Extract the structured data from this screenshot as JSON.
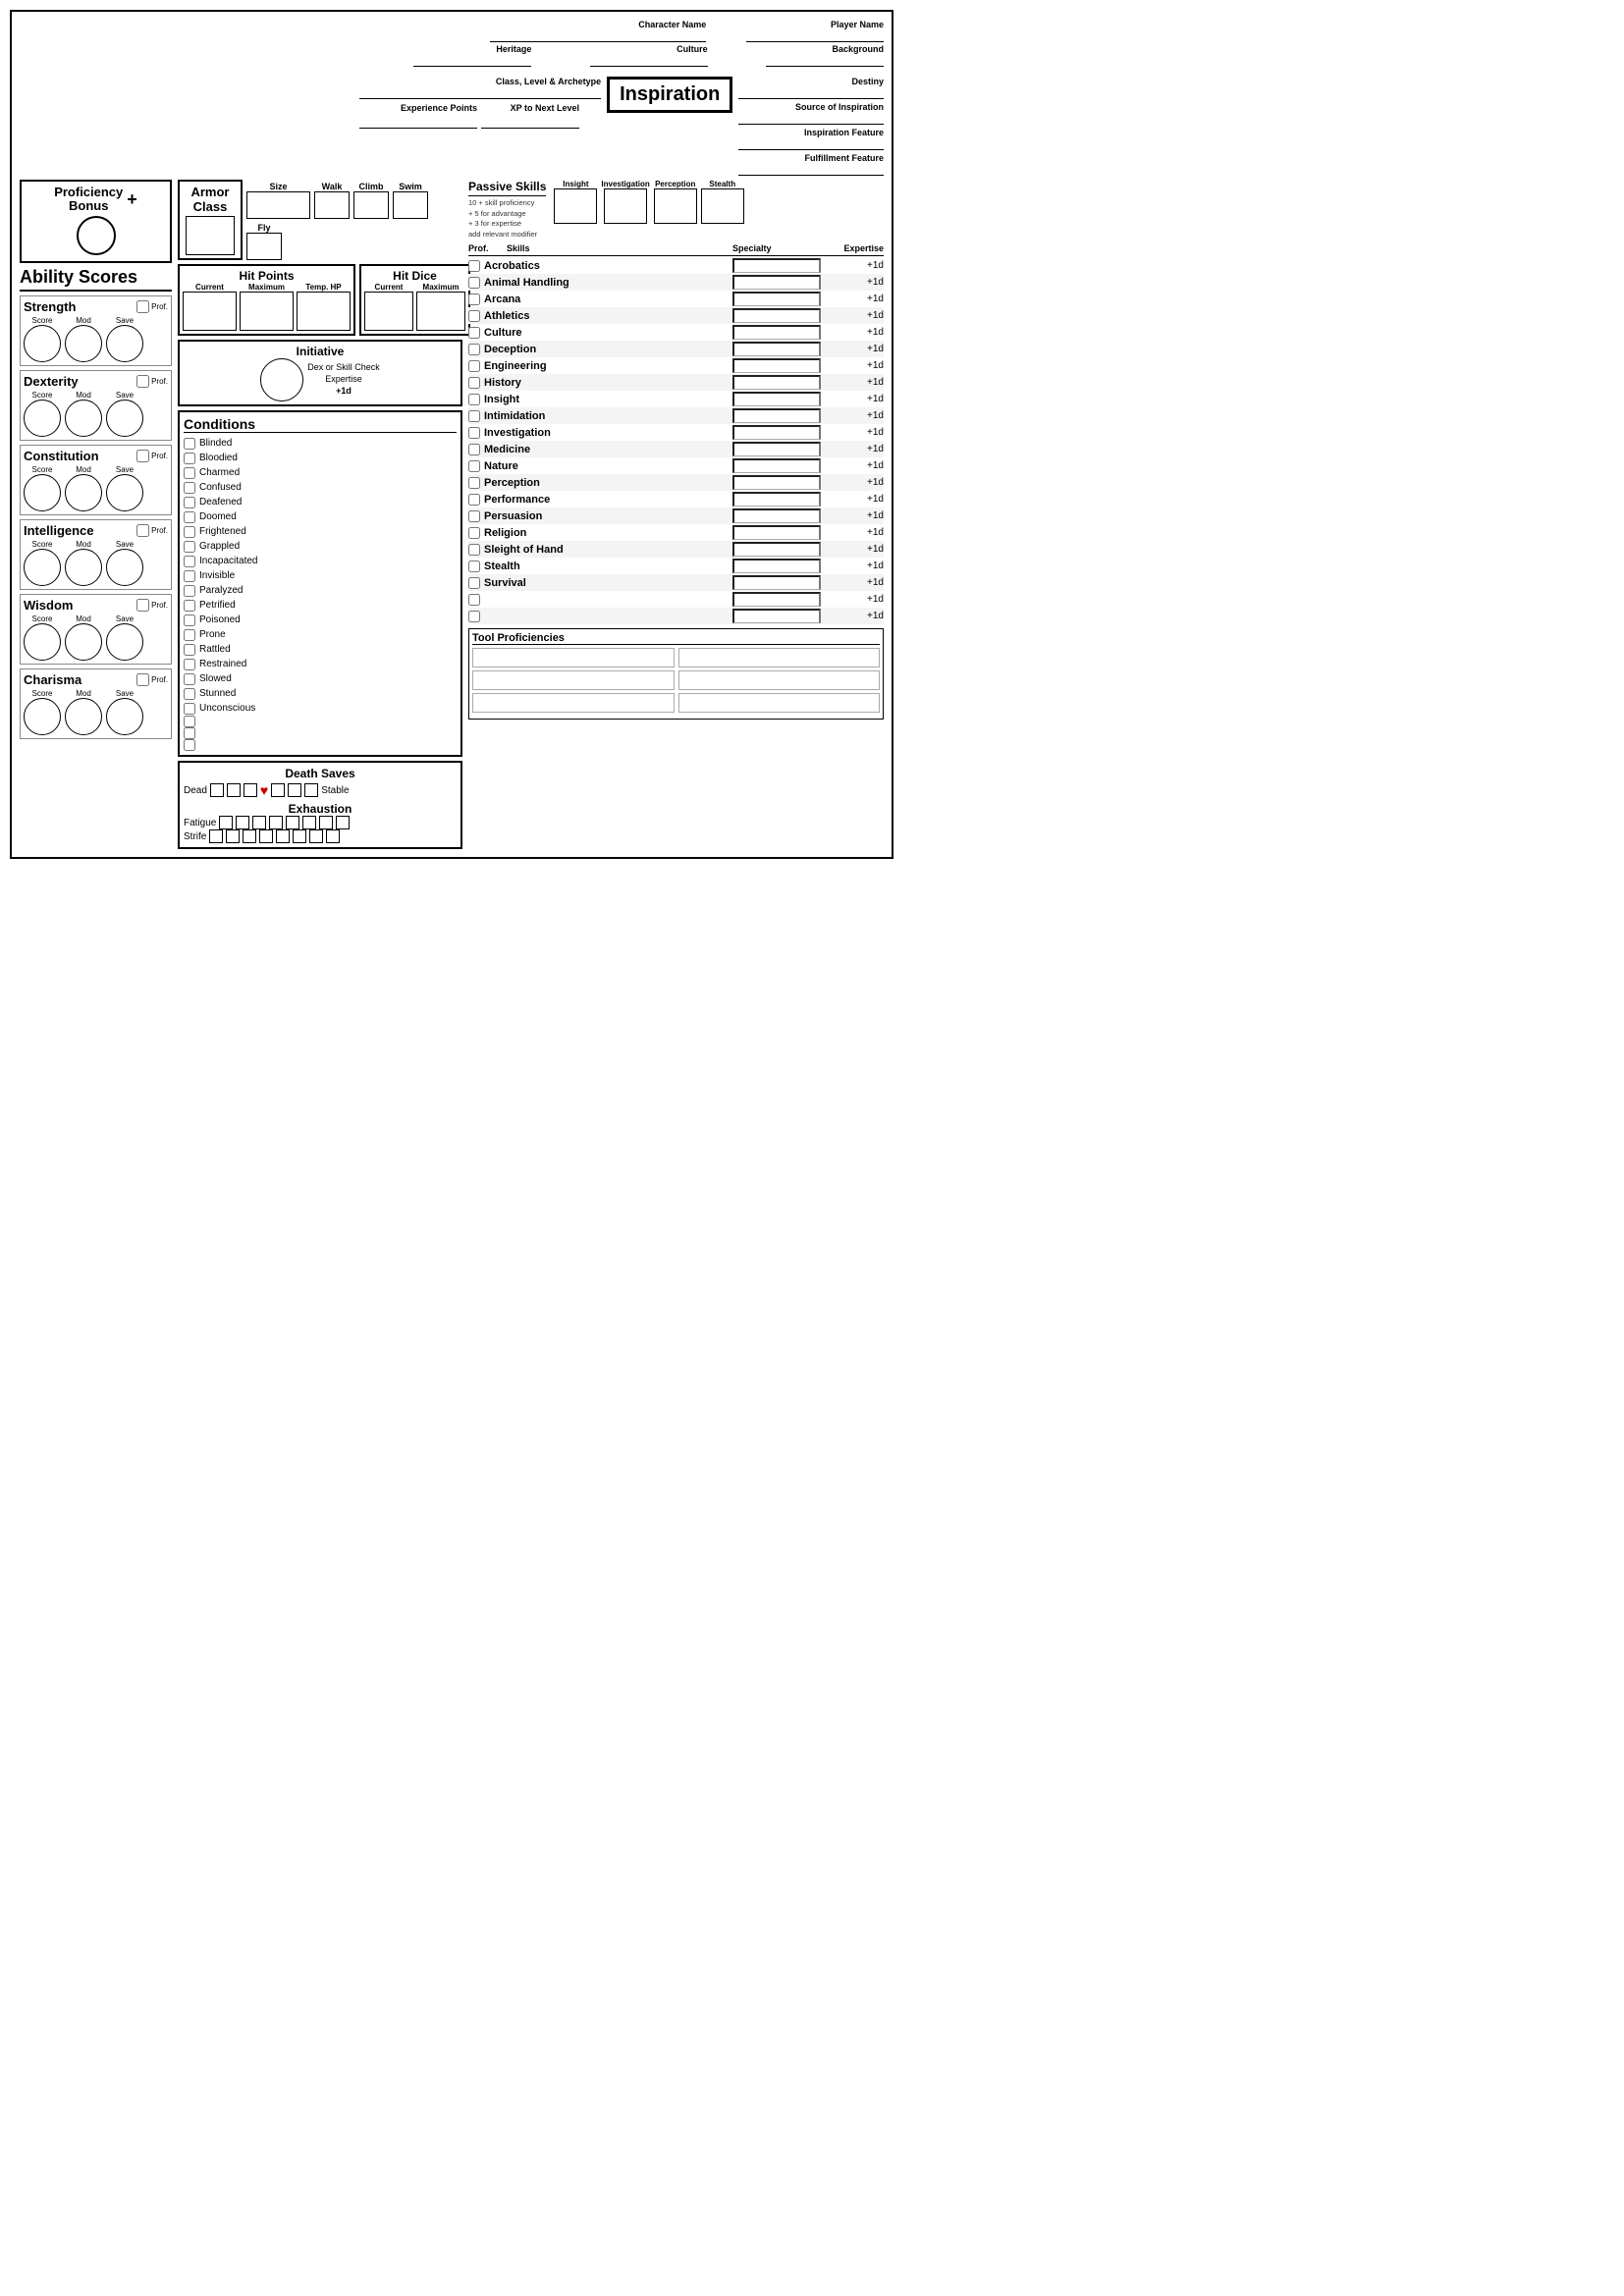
{
  "header": {
    "character_name_label": "Character Name",
    "player_name_label": "Player Name",
    "heritage_label": "Heritage",
    "culture_label": "Culture",
    "background_label": "Background",
    "class_level_label": "Class, Level & Archetype",
    "destiny_label": "Destiny",
    "xp_label": "Experience Points",
    "xp_next_label": "XP to Next Level"
  },
  "inspiration": {
    "label": "Inspiration",
    "source_label": "Source of Inspiration",
    "feature_label": "Inspiration Feature",
    "fulfillment_label": "Fulfillment Feature"
  },
  "proficiency": {
    "label": "Proficiency\nBonus",
    "plus": "+"
  },
  "ability_scores": {
    "section_label": "Ability Scores",
    "abilities": [
      {
        "name": "Strength",
        "score_label": "Score",
        "mod_label": "Mod",
        "save_label": "Save",
        "prof_label": "Prof."
      },
      {
        "name": "Dexterity",
        "score_label": "Score",
        "mod_label": "Mod",
        "save_label": "Save",
        "prof_label": "Prof."
      },
      {
        "name": "Constitution",
        "score_label": "Score",
        "mod_label": "Mod",
        "save_label": "Save",
        "prof_label": "Prof."
      },
      {
        "name": "Intelligence",
        "score_label": "Score",
        "mod_label": "Mod",
        "save_label": "Save",
        "prof_label": "Prof."
      },
      {
        "name": "Wisdom",
        "score_label": "Score",
        "mod_label": "Mod",
        "save_label": "Save",
        "prof_label": "Prof."
      },
      {
        "name": "Charisma",
        "score_label": "Score",
        "mod_label": "Mod",
        "save_label": "Save",
        "prof_label": "Prof."
      }
    ]
  },
  "armor": {
    "label": "Armor\nClass",
    "size_label": "Size",
    "walk_label": "Walk",
    "climb_label": "Climb",
    "swim_label": "Swim",
    "fly_label": "Fly"
  },
  "hit_points": {
    "title": "Hit Points",
    "current_label": "Current",
    "maximum_label": "Maximum",
    "temp_label": "Temp. HP"
  },
  "hit_dice": {
    "title": "Hit Dice",
    "current_label": "Current",
    "maximum_label": "Maximum"
  },
  "initiative": {
    "title": "Initiative",
    "dex_label": "Dex",
    "or_label": "or",
    "skill_check_label": "Skill\nCheck",
    "expertise_label": "Expertise",
    "bonus_label": "+1d"
  },
  "conditions": {
    "title": "Conditions",
    "list": [
      "Blinded",
      "Bloodied",
      "Charmed",
      "Confused",
      "Deafened",
      "Doomed",
      "Frightened",
      "Grappled",
      "Incapacitated",
      "Invisible",
      "Paralyzed",
      "Petrified",
      "Poisoned",
      "Prone",
      "Rattled",
      "Restrained",
      "Slowed",
      "Stunned",
      "Unconscious",
      "",
      "",
      ""
    ]
  },
  "death_saves": {
    "title": "Death Saves",
    "dead_label": "Dead",
    "stable_label": "Stable",
    "exhaustion_title": "Exhaustion",
    "fatigue_label": "Fatigue",
    "strife_label": "Strife"
  },
  "passive_skills": {
    "title": "Passive Skills",
    "notes": "10 + skill proficiency\n+ 5 for advantage\n+ 3 for expertise\nadd relevant modifier",
    "insight_label": "Insight",
    "investigation_label": "Investigation",
    "perception_label": "Perception",
    "stealth_label": "Stealth"
  },
  "skills": {
    "prof_header": "Prof.",
    "skill_header": "Skills",
    "specialty_header": "Specialty",
    "expertise_header": "Expertise",
    "list": [
      {
        "name": "Acrobatics",
        "bonus": "+1d"
      },
      {
        "name": "Animal Handling",
        "bonus": "+1d"
      },
      {
        "name": "Arcana",
        "bonus": "+1d"
      },
      {
        "name": "Athletics",
        "bonus": "+1d"
      },
      {
        "name": "Culture",
        "bonus": "+1d"
      },
      {
        "name": "Deception",
        "bonus": "+1d"
      },
      {
        "name": "Engineering",
        "bonus": "+1d"
      },
      {
        "name": "History",
        "bonus": "+1d"
      },
      {
        "name": "Insight",
        "bonus": "+1d"
      },
      {
        "name": "Intimidation",
        "bonus": "+1d"
      },
      {
        "name": "Investigation",
        "bonus": "+1d"
      },
      {
        "name": "Medicine",
        "bonus": "+1d"
      },
      {
        "name": "Nature",
        "bonus": "+1d"
      },
      {
        "name": "Perception",
        "bonus": "+1d"
      },
      {
        "name": "Performance",
        "bonus": "+1d"
      },
      {
        "name": "Persuasion",
        "bonus": "+1d"
      },
      {
        "name": "Religion",
        "bonus": "+1d"
      },
      {
        "name": "Sleight of Hand",
        "bonus": "+1d"
      },
      {
        "name": "Stealth",
        "bonus": "+1d"
      },
      {
        "name": "Survival",
        "bonus": "+1d"
      },
      {
        "name": "",
        "bonus": "+1d"
      },
      {
        "name": "",
        "bonus": "+1d"
      }
    ]
  },
  "tool_proficiencies": {
    "title": "Tool Proficiencies"
  }
}
